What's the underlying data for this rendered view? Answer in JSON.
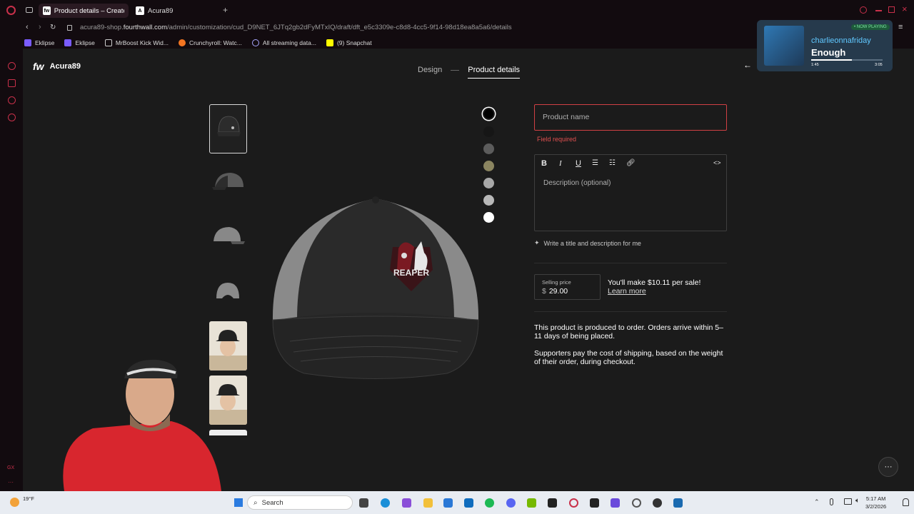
{
  "browser": {
    "tabs": [
      {
        "label": "Product details – Create a",
        "active": true
      },
      {
        "label": "Acura89",
        "active": false
      }
    ],
    "url_prefix": "acura89-shop.",
    "url_domain": "fourthwall.com",
    "url_path": "/admin/customization/cud_D9NET_6JTq2gb2dFyMTxIQ/draft/dft_e5c3309e-c8d8-4cc5-9f14-98d18ea8a5a6/details",
    "bookmarks": [
      "Eklipse",
      "Eklipse",
      "MrBoost Kick Wid...",
      "Crunchyroll: Watc...",
      "All streaming data...",
      "(9) Snapchat"
    ]
  },
  "header": {
    "logo": "fw",
    "shop_name": "Acura89",
    "step_design": "Design",
    "step_details": "Product details"
  },
  "product": {
    "color_swatches": [
      "#000000",
      "#1a1a1a",
      "#5c5c5c",
      "#8b8560",
      "#a8a8a8",
      "#b8b8b8",
      "#ffffff"
    ],
    "logo_text": "REAPER"
  },
  "form": {
    "name_placeholder": "Product name",
    "name_error": "Field required",
    "description_placeholder": "Description (optional)",
    "toolbar": {
      "bold": "B",
      "italic": "I",
      "underline": "U",
      "code": "<>"
    },
    "ai_button": "Write a title and description for me",
    "price_label": "Selling price",
    "currency": "$",
    "price": "29.00",
    "earn_text": "You'll make $10.11 per sale!",
    "learn_more": "Learn more",
    "info_1": "This product is produced to order. Orders arrive within 5–11 days of being placed.",
    "info_2": "Supporters pay the cost of shipping, based on the weight of their order, during checkout."
  },
  "now_playing": {
    "badge": "• NOW PLAYING",
    "artist": "charlieonnafriday",
    "title": "Enough",
    "elapsed": "1:45",
    "total": "3:05",
    "progress": 0.57
  },
  "taskbar": {
    "weather": "19°F",
    "search_placeholder": "Search",
    "time": "5:17 AM",
    "date": "3/2/2026"
  }
}
